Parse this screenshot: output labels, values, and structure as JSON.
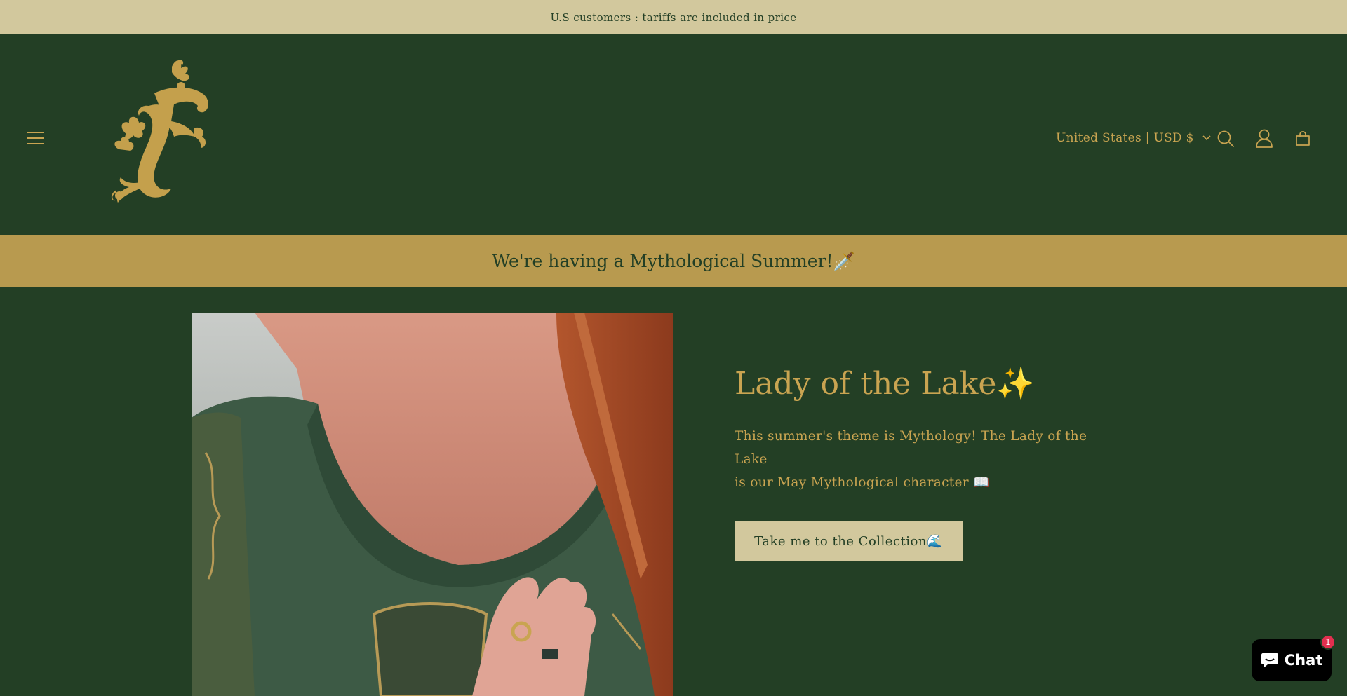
{
  "announcement": {
    "text": "U.S customers : tariffs are included in price"
  },
  "header": {
    "locale_label": "United States | USD $",
    "icons": [
      "menu-icon",
      "search-icon",
      "account-icon",
      "cart-icon"
    ]
  },
  "promo": {
    "text": "We're having a Mythological Summer!🗡️"
  },
  "hero": {
    "title": "Lady of the Lake✨",
    "description_line1": "This summer's theme is Mythology! The Lady of the Lake",
    "description_line2": "is our May Mythological character 📖",
    "button_label": "Take me to the Collection🌊"
  },
  "chat": {
    "label": "Chat",
    "badge_count": "1"
  },
  "colors": {
    "background": "#233f25",
    "gold": "#c9a451",
    "announcement_bg": "#d2c89d",
    "promo_bg": "#b89a4f"
  }
}
